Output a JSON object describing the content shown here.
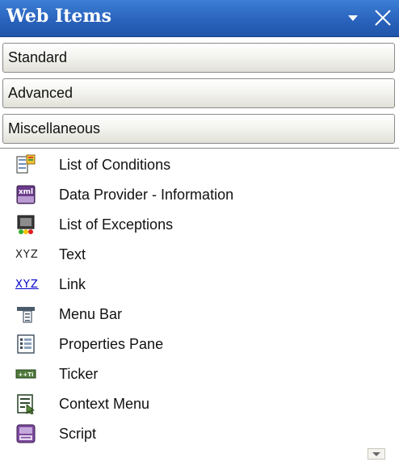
{
  "panel": {
    "title": "Web Items",
    "dropdown_icon": "chevron-down-icon",
    "close_icon": "close-icon"
  },
  "categories": [
    {
      "label": "Standard"
    },
    {
      "label": "Advanced"
    },
    {
      "label": "Miscellaneous"
    }
  ],
  "items": [
    {
      "label": "List of Conditions",
      "icon": "list-of-conditions-icon"
    },
    {
      "label": "Data Provider - Information",
      "icon": "xml-icon",
      "icon_text": "xml"
    },
    {
      "label": "List of Exceptions",
      "icon": "traffic-light-icon"
    },
    {
      "label": "Text",
      "icon": "text-icon",
      "icon_text": "XYZ"
    },
    {
      "label": "Link",
      "icon": "link-icon",
      "icon_text": "XYZ"
    },
    {
      "label": "Menu Bar",
      "icon": "menu-bar-icon"
    },
    {
      "label": "Properties Pane",
      "icon": "properties-pane-icon"
    },
    {
      "label": "Ticker",
      "icon": "ticker-icon",
      "icon_text": "++Ti"
    },
    {
      "label": "Context Menu",
      "icon": "context-menu-icon"
    },
    {
      "label": "Script",
      "icon": "script-icon"
    }
  ],
  "colors": {
    "titlebar": "#2a63bd",
    "link_blue": "#0000cc"
  }
}
